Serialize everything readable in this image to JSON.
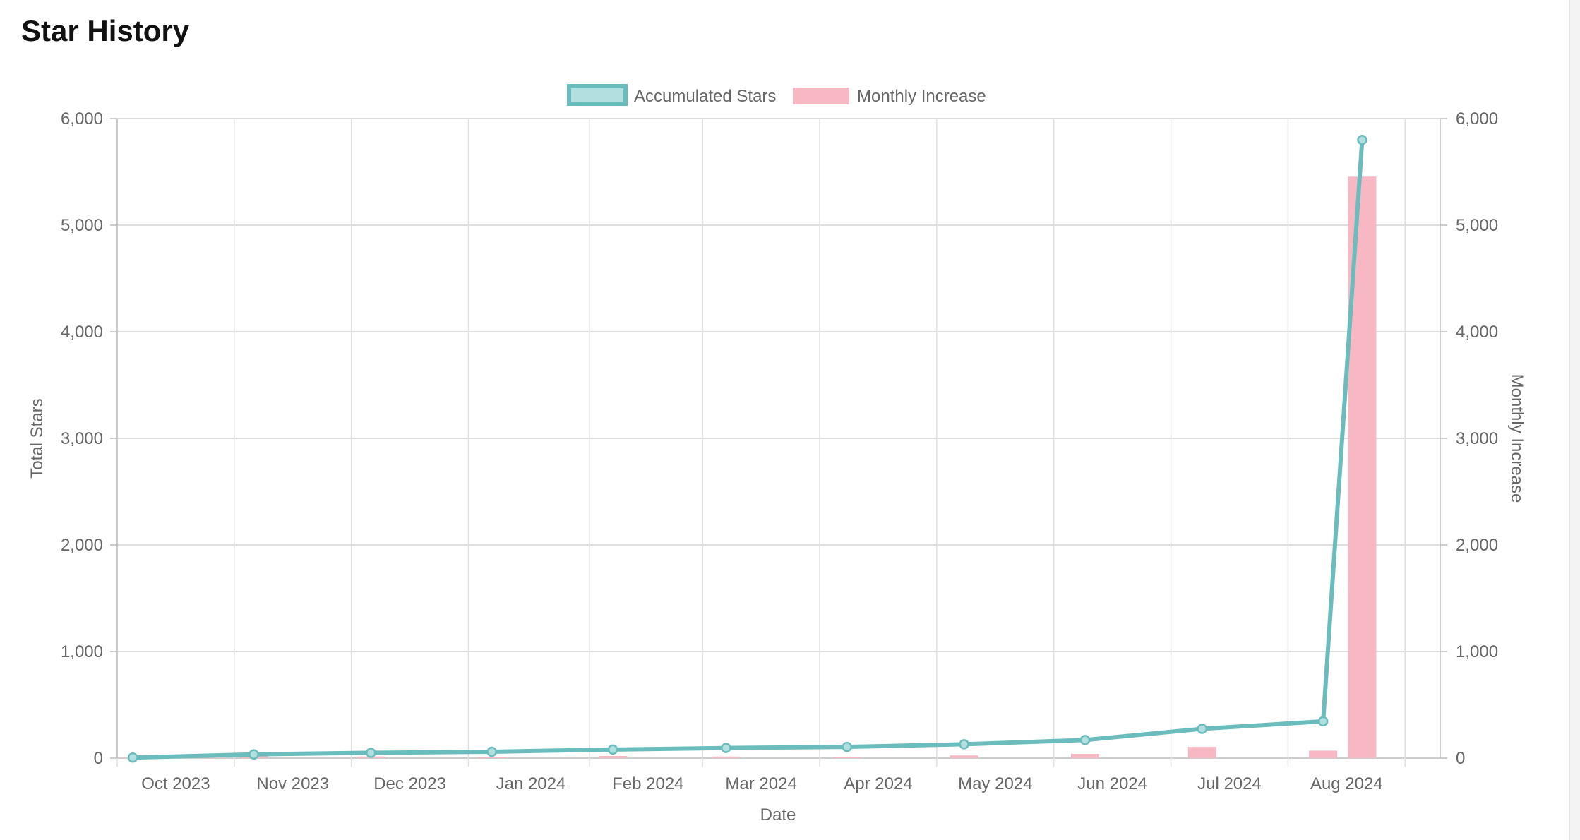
{
  "page": {
    "title": "Star History"
  },
  "colors": {
    "line": "#6bbdbd",
    "line_fill": "#b2e0e0",
    "bar": "#f7b7c3",
    "grid": "#e0e0e0",
    "axis": "#bdbdbd",
    "text": "#666666"
  },
  "chart_data": {
    "type": "line",
    "x_axis_type": "time",
    "xlabel": "Date",
    "ylabel_left": "Total Stars",
    "ylabel_right": "Monthly Increase",
    "ylim_left": [
      0,
      6000
    ],
    "ylim_right": [
      0,
      6000
    ],
    "yticks": [
      "0",
      "1,000",
      "2,000",
      "3,000",
      "4,000",
      "5,000",
      "6,000"
    ],
    "ytick_values": [
      0,
      1000,
      2000,
      3000,
      4000,
      5000,
      6000
    ],
    "x_ticks": [
      "Oct 2023",
      "Nov 2023",
      "Dec 2023",
      "Jan 2024",
      "Feb 2024",
      "Mar 2024",
      "Apr 2024",
      "May 2024",
      "Jun 2024",
      "Jul 2024",
      "Aug 2024"
    ],
    "x_range": [
      "2023-09-27",
      "2024-08-31"
    ],
    "grid": true,
    "legend_position": "top-center",
    "series": [
      {
        "name": "Accumulated Stars",
        "kind": "line",
        "axis": "left",
        "x": [
          "2023-10-01",
          "2023-11-01",
          "2023-12-01",
          "2024-01-01",
          "2024-02-01",
          "2024-03-01",
          "2024-04-01",
          "2024-05-01",
          "2024-06-01",
          "2024-07-01",
          "2024-08-01",
          "2024-08-11"
        ],
        "values": [
          5,
          35,
          50,
          60,
          80,
          95,
          105,
          130,
          170,
          275,
          345,
          5800
        ]
      },
      {
        "name": "Monthly Increase",
        "kind": "bar",
        "axis": "right",
        "x": [
          "2023-10-01",
          "2023-11-01",
          "2023-12-01",
          "2024-01-01",
          "2024-02-01",
          "2024-03-01",
          "2024-04-01",
          "2024-05-01",
          "2024-06-01",
          "2024-07-01",
          "2024-08-01",
          "2024-08-11"
        ],
        "values": [
          5,
          30,
          15,
          10,
          20,
          15,
          10,
          25,
          40,
          105,
          70,
          5455
        ]
      }
    ]
  }
}
